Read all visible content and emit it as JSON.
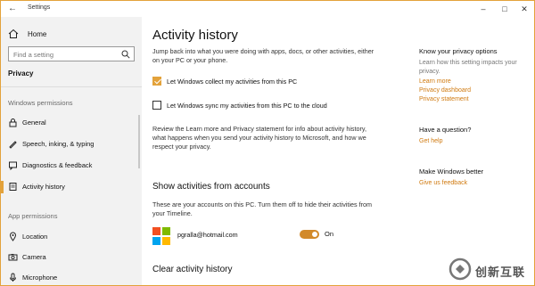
{
  "window": {
    "title": "Settings"
  },
  "sidebar": {
    "home_label": "Home",
    "search_placeholder": "Find a setting",
    "category": "Privacy",
    "sections": [
      {
        "label": "Windows permissions"
      },
      {
        "label": "App permissions"
      }
    ],
    "items": [
      {
        "label": "General",
        "icon": "lock-icon"
      },
      {
        "label": "Speech, inking, & typing",
        "icon": "pen-icon"
      },
      {
        "label": "Diagnostics & feedback",
        "icon": "feedback-icon"
      },
      {
        "label": "Activity history",
        "icon": "activity-history-icon",
        "active": true
      },
      {
        "label": "Location",
        "icon": "location-icon"
      },
      {
        "label": "Camera",
        "icon": "camera-icon"
      },
      {
        "label": "Microphone",
        "icon": "microphone-icon"
      }
    ]
  },
  "main": {
    "title": "Activity history",
    "intro": "Jump back into what you were doing with apps, docs, or other activities, either on your PC or your phone.",
    "checkbox_collect": {
      "label": "Let Windows collect my activities from this PC",
      "checked": true
    },
    "checkbox_sync": {
      "label": "Let Windows sync my activities from this PC to the cloud",
      "checked": false
    },
    "review_text": "Review the Learn more and Privacy statement for info about activity history, what happens when you send your activity history to Microsoft, and how we respect your privacy.",
    "accounts_title": "Show activities from accounts",
    "accounts_desc": "These are your accounts on this PC. Turn them off to hide their activities from your Timeline.",
    "account": {
      "email": "pgralla@hotmail.com",
      "toggle_state": "On",
      "toggle_on": true
    },
    "clear_title": "Clear activity history"
  },
  "right": {
    "privacy_heading": "Know your privacy options",
    "privacy_text": "Learn how this setting impacts your privacy.",
    "links": [
      "Learn more",
      "Privacy dashboard",
      "Privacy statement"
    ],
    "question_heading": "Have a question?",
    "help_link": "Get help",
    "better_heading": "Make Windows better",
    "feedback_link": "Give us feedback"
  },
  "watermark": {
    "text": "创新互联"
  },
  "colors": {
    "accent": "#e3a23b",
    "link": "#d07a10"
  }
}
